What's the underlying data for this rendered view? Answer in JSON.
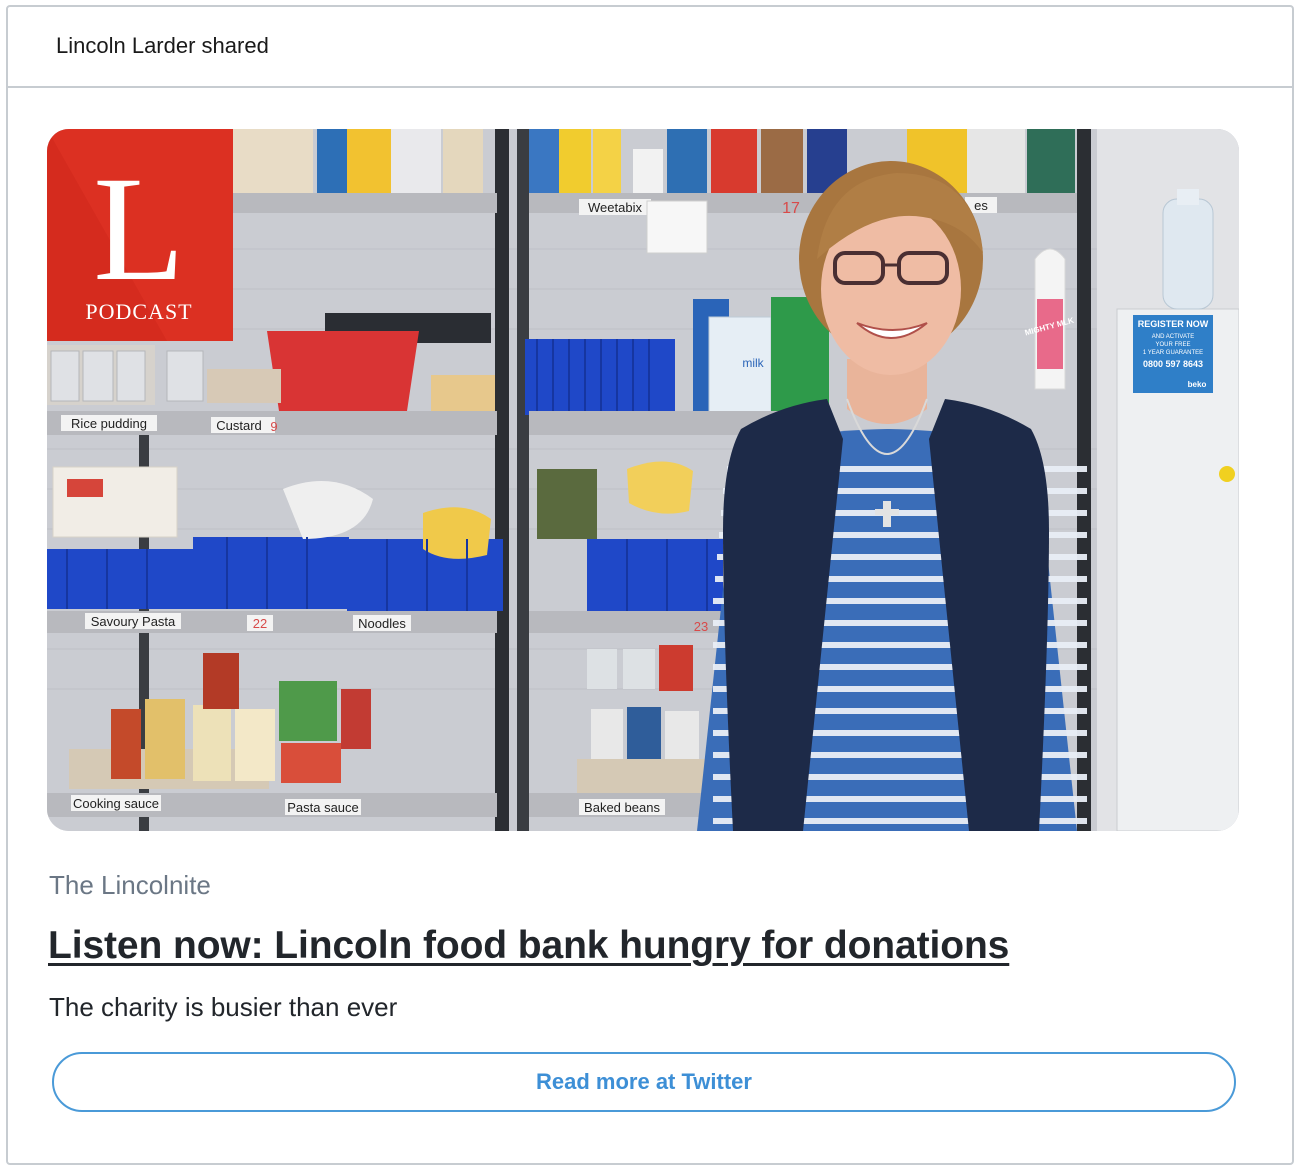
{
  "header": {
    "shared_by": "Lincoln Larder shared"
  },
  "media": {
    "logo_letter": "L",
    "logo_caption": "PODCAST",
    "shelf_labels": {
      "rice_pudding": "Rice pudding",
      "custard": "Custard",
      "weetabix": "Weetabix",
      "savoury_pasta": "Savoury Pasta",
      "noodles": "Noodles",
      "cooking_sauce": "Cooking sauce",
      "pasta_sauce": "Pasta sauce",
      "baked_beans": "Baked beans",
      "num_17": "17",
      "num_22": "22",
      "num_23": "23",
      "num_9": "9",
      "cereal_tail": "es"
    },
    "fridge_sign": {
      "line1": "REGISTER NOW",
      "line2": "AND ACTIVATE",
      "line3": "YOUR FREE",
      "line4": "1 YEAR GUARANTEE",
      "phone": "0800 597 8643",
      "brand": "beko"
    },
    "milk_carton": "milk",
    "mighty_milk": "MIGHTY MLK"
  },
  "article": {
    "source": "The Lincolnite",
    "headline": "Listen now: Lincoln food bank hungry for donations",
    "subtitle": "The charity is busier than ever"
  },
  "actions": {
    "read_more_label": "Read more at Twitter"
  },
  "colors": {
    "accent": "#4a9ad8",
    "logo_red": "#d52b1e",
    "border": "#c7ccd1"
  }
}
